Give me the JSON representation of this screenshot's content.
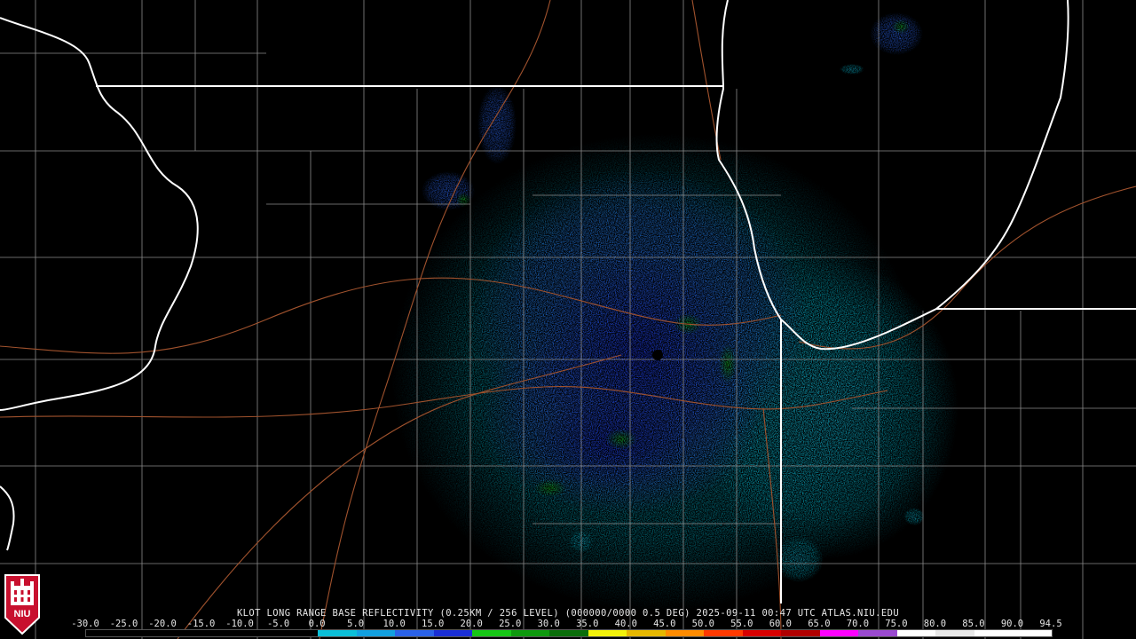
{
  "product": {
    "caption": "KLOT LONG RANGE BASE REFLECTIVITY (0.25KM / 256 LEVEL) (000000/0000 0.5 DEG) 2025-09-11 00:47 UTC  ATLAS.NIU.EDU"
  },
  "colorbar": {
    "tick_labels": [
      "-30.0",
      "-25.0",
      "-20.0",
      "-15.0",
      "-10.0",
      "-5.0",
      "0.0",
      "5.0",
      "10.0",
      "15.0",
      "20.0",
      "25.0",
      "30.0",
      "35.0",
      "40.0",
      "45.0",
      "50.0",
      "55.0",
      "60.0",
      "65.0",
      "70.0",
      "75.0",
      "80.0",
      "85.0",
      "90.0",
      "94.5"
    ],
    "segment_colors": [
      "#000000",
      "#000000",
      "#000000",
      "#000000",
      "#000000",
      "#000000",
      "#0bbfd8",
      "#12a0e0",
      "#2a62e8",
      "#1a2fd6",
      "#16c716",
      "#0e9a0e",
      "#0a6e0a",
      "#f2f20a",
      "#e6b800",
      "#ff8c00",
      "#ff3a00",
      "#d80000",
      "#b00000",
      "#ff00ff",
      "#9a4ad0",
      "#ffffff",
      "#e8e8e8",
      "#ffffff",
      "#ffffff"
    ]
  },
  "map_colors": {
    "background": "#000000",
    "state_border": "#ffffff",
    "county_border": "#8a8a8a",
    "highway": "#a0522d",
    "echo_light_cyan": "#0bbfd8",
    "echo_mid_blue": "#2a62e8",
    "echo_dark_blue": "#1a2fd6",
    "echo_green": "#16c716"
  },
  "logo": {
    "text": "NIU",
    "background": "#c8102e"
  }
}
